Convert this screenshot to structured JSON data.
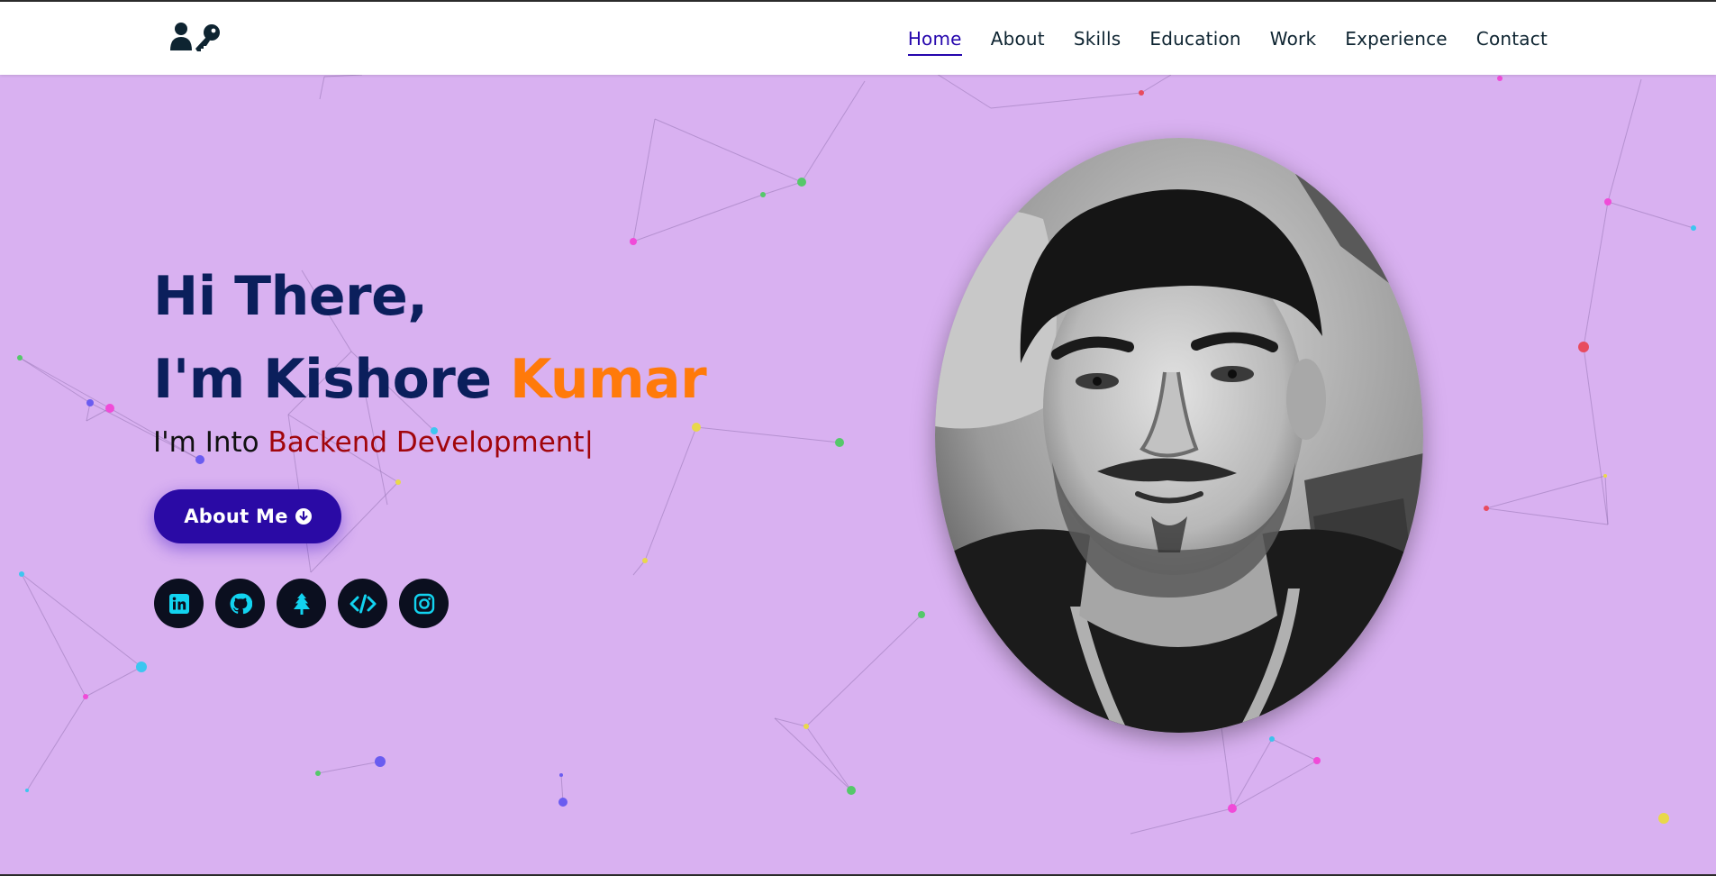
{
  "header": {
    "logo_icon": "user-key-icon",
    "nav": [
      {
        "label": "Home",
        "active": true
      },
      {
        "label": "About",
        "active": false
      },
      {
        "label": "Skills",
        "active": false
      },
      {
        "label": "Education",
        "active": false
      },
      {
        "label": "Work",
        "active": false
      },
      {
        "label": "Experience",
        "active": false
      },
      {
        "label": "Contact",
        "active": false
      }
    ]
  },
  "hero": {
    "line1": "Hi There,",
    "line2_prefix": "I'm Kishore ",
    "line2_accent": "Kumar",
    "typing_prefix": "I'm Into ",
    "typing_role": "Backend Development",
    "typing_cursor": "|",
    "about_button": "About Me",
    "about_button_icon": "arrow-down-circle-icon",
    "socials": [
      {
        "name": "linkedin",
        "icon": "linkedin-icon"
      },
      {
        "name": "github",
        "icon": "github-icon"
      },
      {
        "name": "linktree",
        "icon": "tree-icon"
      },
      {
        "name": "code",
        "icon": "code-icon"
      },
      {
        "name": "instagram",
        "icon": "instagram-icon"
      }
    ],
    "profile_image": "profile-photo"
  },
  "colors": {
    "background": "#d9b1f1",
    "heading": "#0b1f5c",
    "accent": "#ff7a0a",
    "role": "#a1050b",
    "button": "#2a0aa5",
    "nav_active": "#2506ad",
    "social_bg": "#0b0f1f",
    "social_icon": "#12d3f0"
  }
}
